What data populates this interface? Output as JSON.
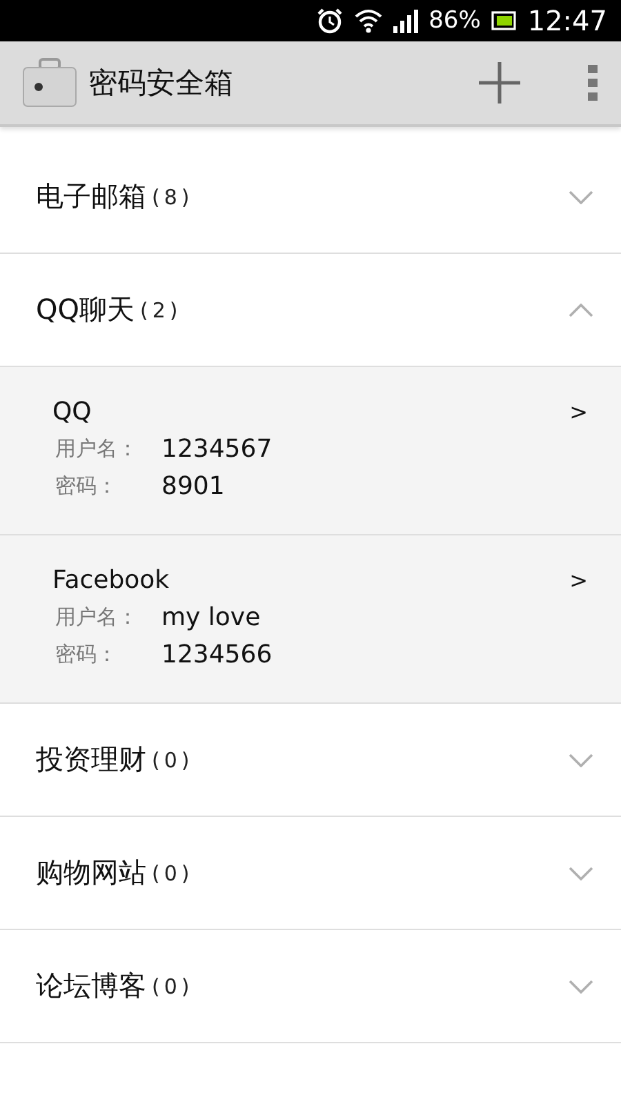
{
  "status_bar": {
    "battery": "86%",
    "time": "12:47"
  },
  "app_bar": {
    "title": "密码安全箱"
  },
  "categories": [
    {
      "name": "电子邮箱",
      "count": "(8)",
      "expanded": false
    },
    {
      "name": "QQ聊天",
      "count": "(2)",
      "expanded": true,
      "entries": [
        {
          "title": "QQ",
          "arrow": ">",
          "username_label": "用户名：",
          "username": "1234567",
          "password_label": "密码：",
          "password": "8901"
        },
        {
          "title": "Facebook",
          "arrow": ">",
          "username_label": "用户名：",
          "username": "my love",
          "password_label": "密码：",
          "password": "1234566"
        }
      ]
    },
    {
      "name": "投资理财",
      "count": "(0)",
      "expanded": false
    },
    {
      "name": "购物网站",
      "count": "(0)",
      "expanded": false
    },
    {
      "name": "论坛博客",
      "count": "(0)",
      "expanded": false
    }
  ]
}
